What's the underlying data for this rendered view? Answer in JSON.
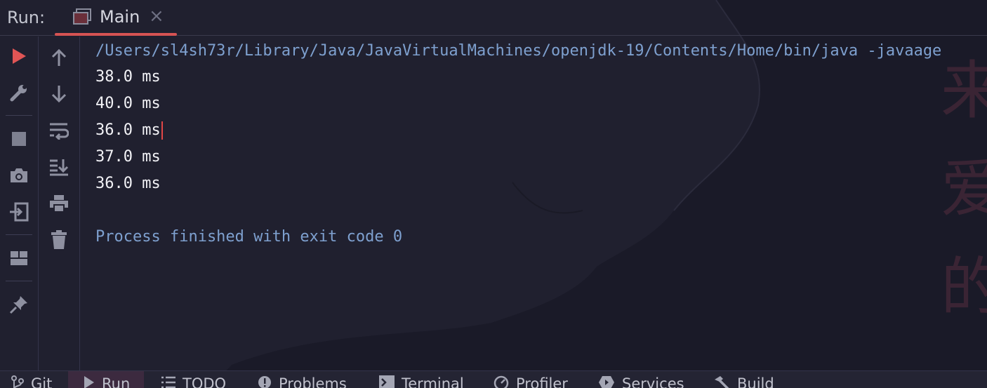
{
  "header": {
    "run_label": "Run:",
    "tab_label": "Main",
    "tab_close": "×"
  },
  "accent_color": "#d65353",
  "console": {
    "command": "/Users/sl4sh73r/Library/Java/JavaVirtualMachines/openjdk-19/Contents/Home/bin/java -javaage",
    "output_lines": [
      "38.0 ms",
      "40.0 ms",
      "36.0 ms",
      "37.0 ms",
      "36.0 ms"
    ],
    "process_message": "Process finished with exit code 0"
  },
  "toolbar_left": [
    "rerun-icon",
    "wrench-icon",
    "stop-icon",
    "camera-icon",
    "import-icon",
    "layout-icon",
    "pin-icon"
  ],
  "toolbar_right": [
    "arrow-up-icon",
    "arrow-down-icon",
    "soft-wrap-icon",
    "scroll-to-end-icon",
    "print-icon",
    "trash-icon"
  ],
  "bottom_bar": {
    "git": "Git",
    "run": "Run",
    "todo": "TODO",
    "problems": "Problems",
    "terminal": "Terminal",
    "profiler": "Profiler",
    "services": "Services",
    "build": "Build"
  }
}
